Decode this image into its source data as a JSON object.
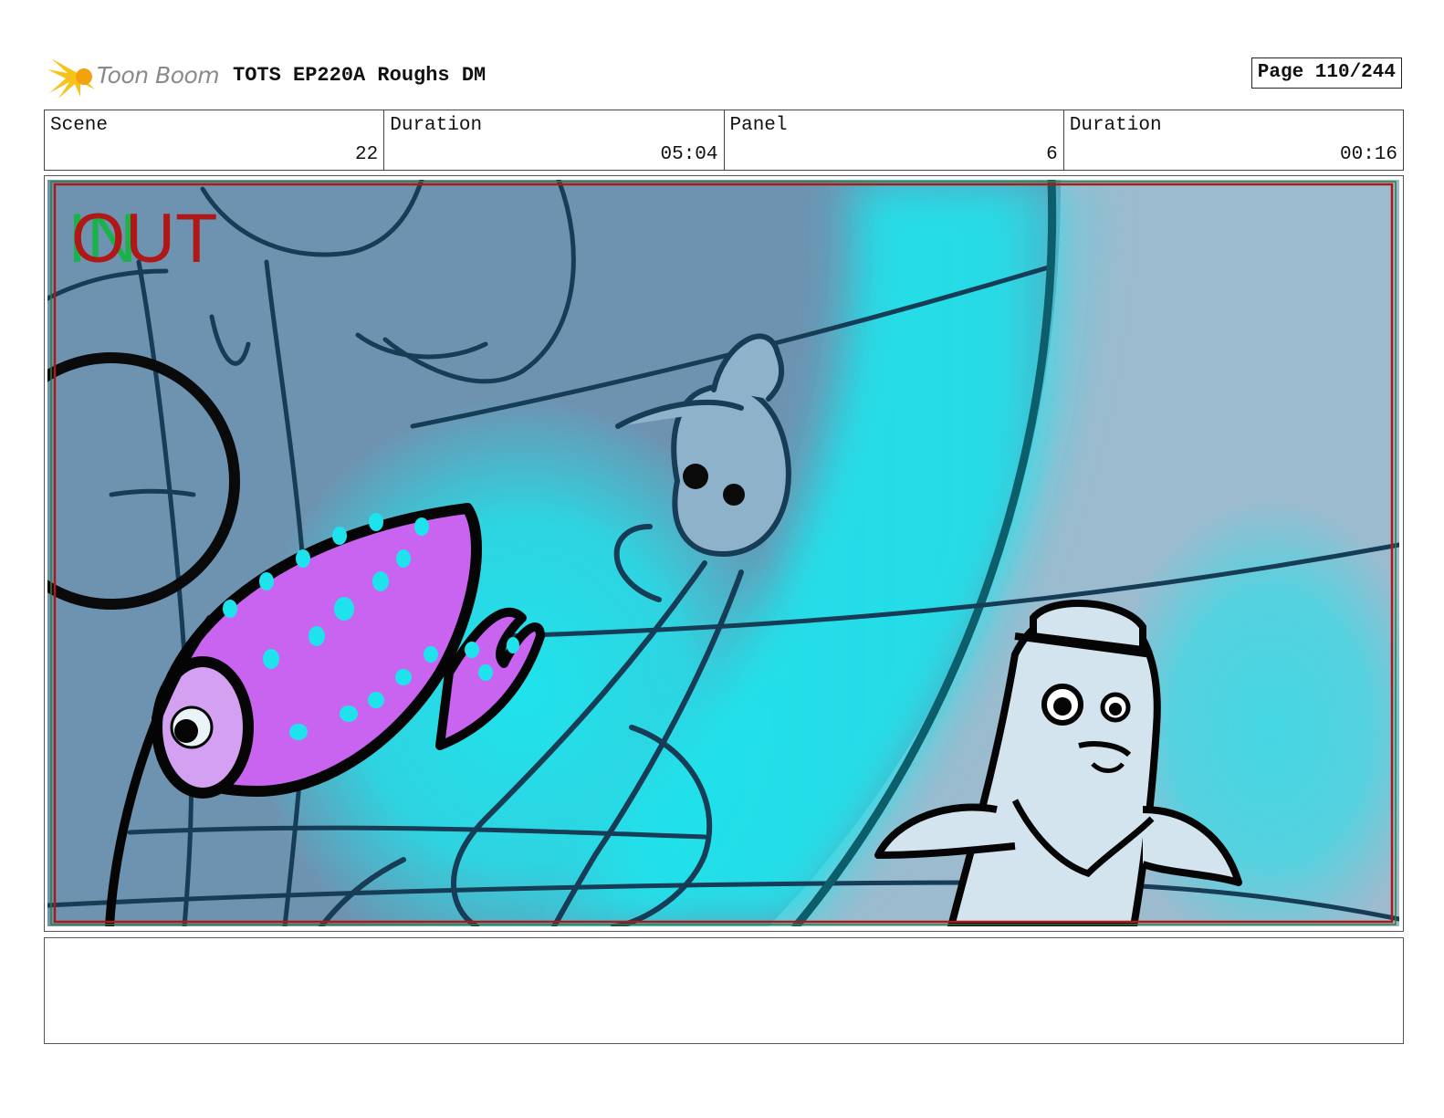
{
  "header": {
    "logo_text": "Toon Boom",
    "logo_icon": "starburst-logo-icon",
    "title": "TOTS EP220A Roughs DM",
    "page": "Page 110/244"
  },
  "info": {
    "scene_label": "Scene",
    "scene_value": "22",
    "scene_duration_label": "Duration",
    "scene_duration_value": "05:04",
    "panel_label": "Panel",
    "panel_value": "6",
    "panel_duration_label": "Duration",
    "panel_duration_value": "00:16"
  },
  "panel": {
    "in_marker": "IN",
    "out_marker": "OUT",
    "colors": {
      "background": "#6e93b1",
      "glow": "#1fe3ec",
      "egg": "#c864ef",
      "frame_red": "#b01818",
      "in_green": "#19b34a"
    }
  },
  "notes": {
    "text": ""
  }
}
